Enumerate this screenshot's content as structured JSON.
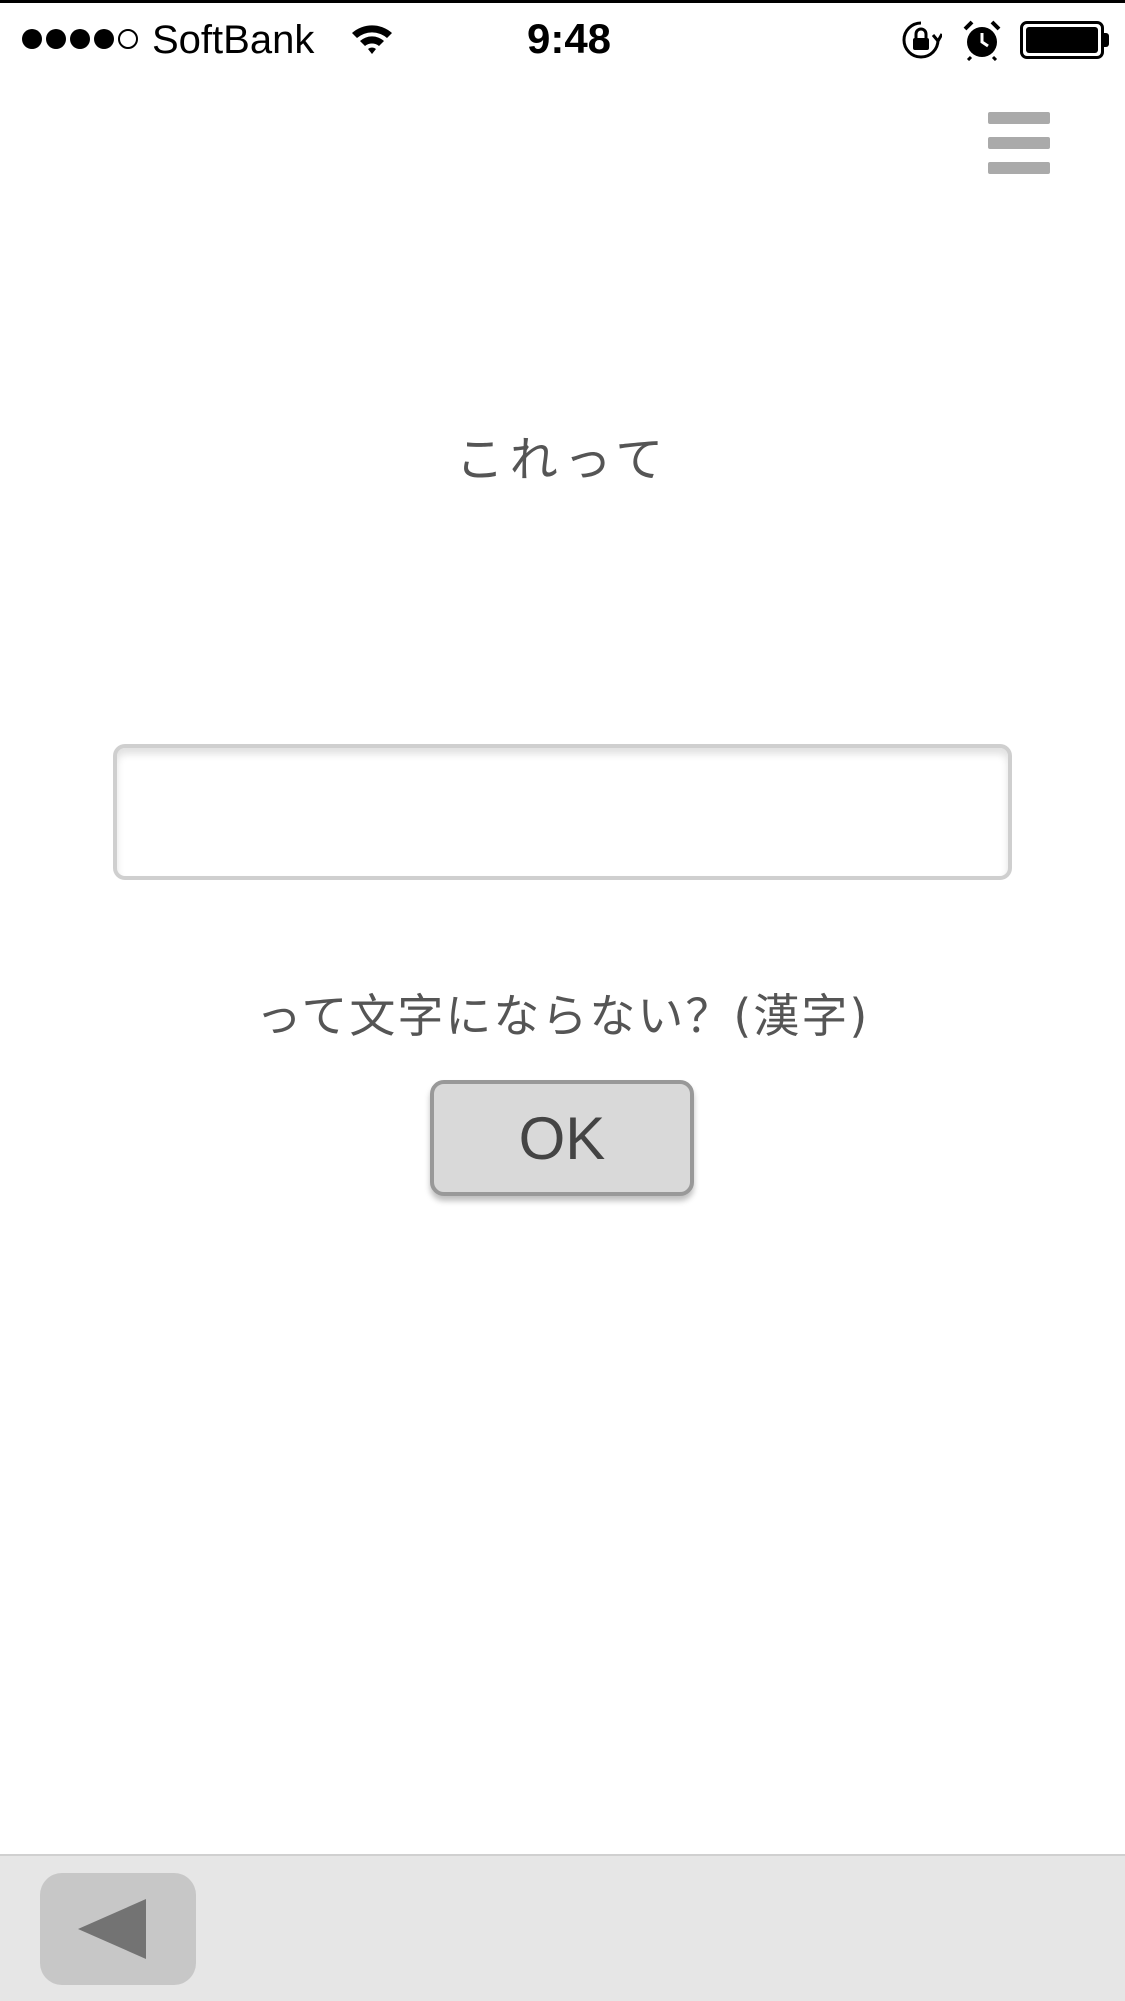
{
  "status_bar": {
    "signal_icon": "signal-dots-icon",
    "carrier": "SoftBank",
    "wifi_icon": "wifi-icon",
    "time": "9:48",
    "rotation_lock_icon": "rotation-lock-icon",
    "alarm_icon": "alarm-icon",
    "battery_icon": "battery-icon",
    "battery_level": 1.0
  },
  "header": {
    "menu_icon": "hamburger-menu-icon"
  },
  "quiz": {
    "prompt_top": "これって",
    "answer_value": "",
    "answer_placeholder": "",
    "prompt_bottom": "って文字にならない？(漢字)",
    "ok_label": "OK"
  },
  "toolbar": {
    "back_icon": "back-arrow-icon"
  },
  "colors": {
    "text": "#555555",
    "toolbar_bg": "#e6e6e6",
    "button_bg": "#d9d9d9",
    "menu_icon": "#aaaaaa"
  }
}
